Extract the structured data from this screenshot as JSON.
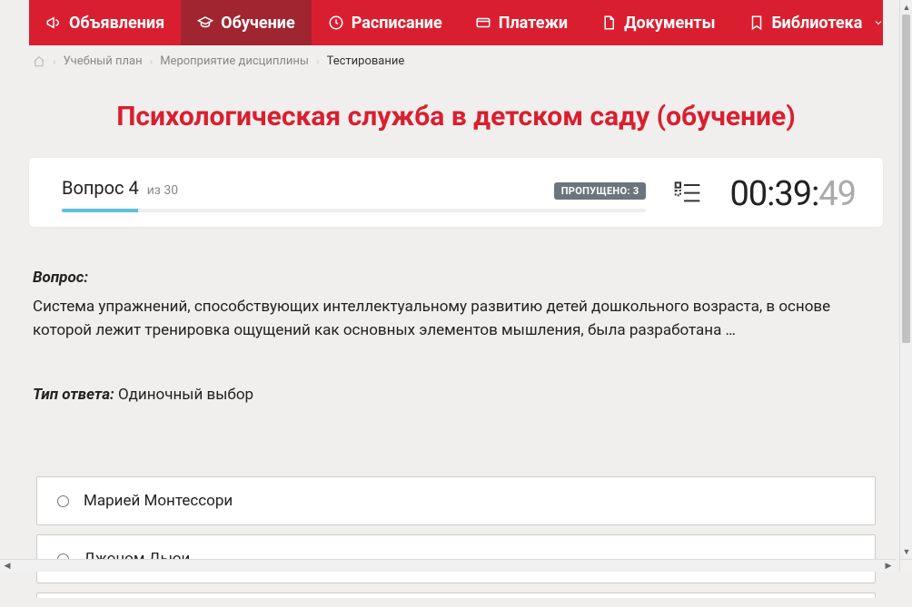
{
  "nav": {
    "items": [
      {
        "label": "Объявления",
        "icon": "megaphone-icon",
        "active": false,
        "dropdown": false
      },
      {
        "label": "Обучение",
        "icon": "graduation-cap-icon",
        "active": true,
        "dropdown": false
      },
      {
        "label": "Расписание",
        "icon": "clock-icon",
        "active": false,
        "dropdown": false
      },
      {
        "label": "Платежи",
        "icon": "card-icon",
        "active": false,
        "dropdown": false
      },
      {
        "label": "Документы",
        "icon": "document-icon",
        "active": false,
        "dropdown": false
      },
      {
        "label": "Библиотека",
        "icon": "bookmark-icon",
        "active": false,
        "dropdown": true
      }
    ]
  },
  "breadcrumb": {
    "items": [
      {
        "label": "Учебный план",
        "link": true
      },
      {
        "label": "Мероприятие дисциплины",
        "link": true
      },
      {
        "label": "Тестирование",
        "link": false
      }
    ]
  },
  "page_title": "Психологическая служба в детском саду (обучение)",
  "status": {
    "question_word": "Вопрос",
    "question_number": "4",
    "of_word": "из",
    "total": "30",
    "skipped_label": "ПРОПУЩЕНО: 3",
    "progress_percent": 13,
    "timer": {
      "mm": "00",
      "ss": "39",
      "cs": "49"
    }
  },
  "question": {
    "prompt_label": "Вопрос:",
    "text": "Система упражнений, способствующих интеллектуальному развитию детей дошкольного возраста, в основе которой лежит тренировка ощущений как основных элементов мышления, была разработана …",
    "answer_type_label": "Тип ответа:",
    "answer_type": "Одиночный выбор"
  },
  "options": [
    {
      "label": "Марией Монтессори"
    },
    {
      "label": "Джоном Дьюи"
    }
  ]
}
